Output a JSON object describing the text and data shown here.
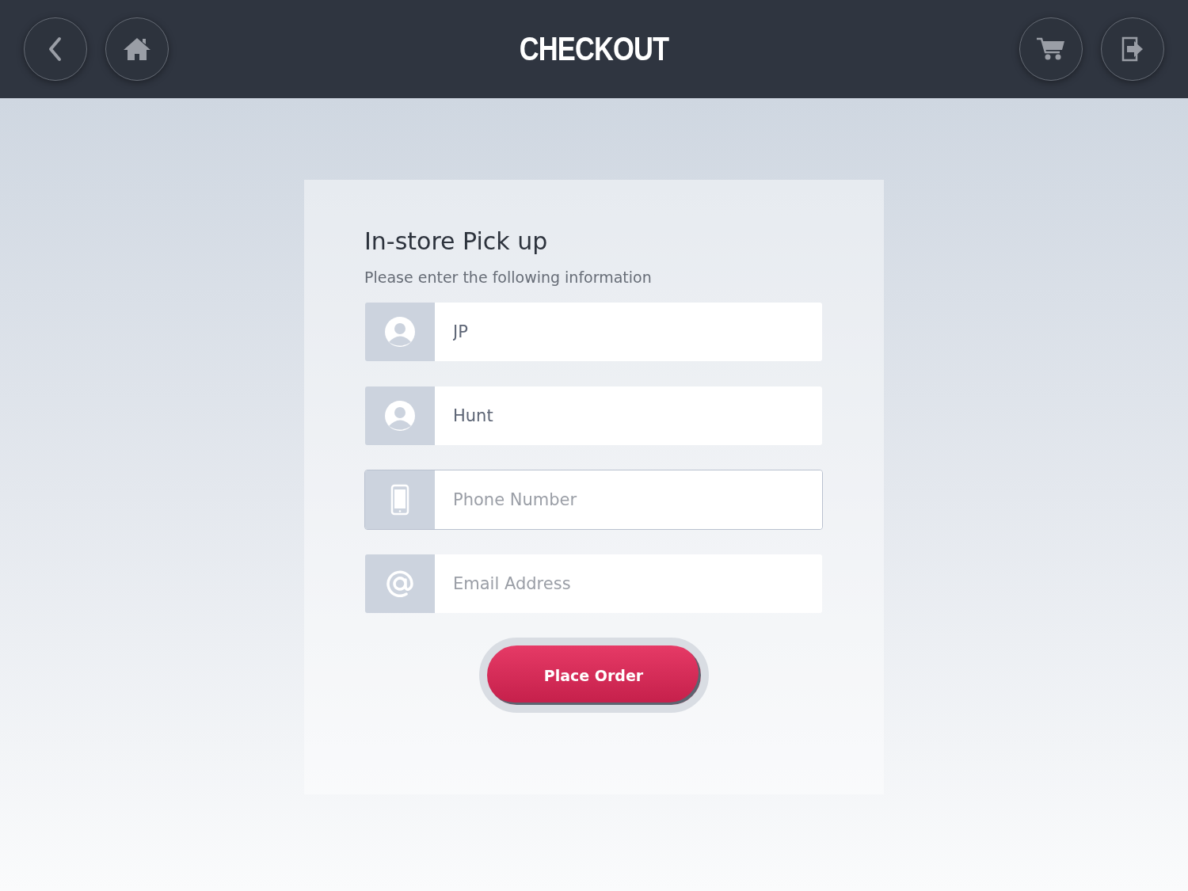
{
  "header": {
    "title": "CHECKOUT"
  },
  "form": {
    "title": "In-store Pick up",
    "subtitle": "Please enter the following information",
    "fields": [
      {
        "kind": "person",
        "value": "JP",
        "focused": false
      },
      {
        "kind": "person",
        "value": "Hunt",
        "focused": false
      },
      {
        "kind": "phone",
        "placeholder": "Phone Number",
        "focused": true
      },
      {
        "kind": "email",
        "placeholder": "Email Address",
        "focused": false
      }
    ],
    "submit": "Place Order"
  }
}
